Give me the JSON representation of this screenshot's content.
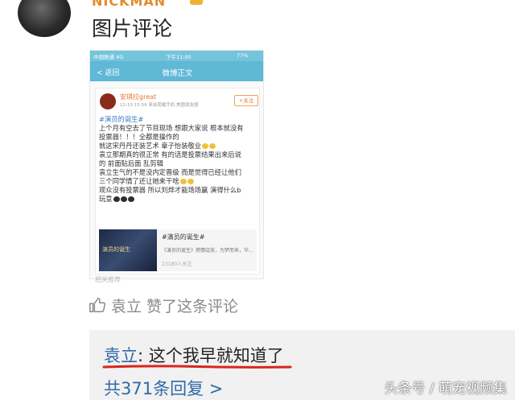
{
  "header": {
    "username": "NICKMAN",
    "comment_text": "图片评论"
  },
  "screenshot": {
    "status": {
      "carrier": "中国联通 4G",
      "time": "下午11:05",
      "battery": "77%"
    },
    "nav": {
      "back": "返回",
      "title": "微博正文"
    },
    "post": {
      "author": "安琪拉great",
      "meta": "12-10 15:59 来自荣耀手机 美图朋友圈",
      "follow": "+关注",
      "hashtag": "#演员的诞生#",
      "lines": [
        "上个月有空去了节目现场 想跟大家说 根本就没有",
        "投票器！！！全都是操作的",
        "就这宋丹丹还装艺术 章子怡装敬业",
        "袁立那期真的很正常 有的话是投票结果出来后说",
        "的 前面贴后面 乱剪辑",
        "袁立生气的不是没内定晋级 而是觉得已经让他们",
        "三个同学情了还让她来干啥",
        "观众没有投票器 所以刘烨才能场场赢 演得什么b",
        "玩意"
      ]
    },
    "topic": {
      "image_text": "演员的诞生",
      "title": "#演员的诞生#",
      "desc": "《演员的诞生》燃情绽放，为梦而来，华...",
      "count": "23180人关注"
    },
    "recommend": "相关推荐"
  },
  "like": {
    "text": "袁立 赞了这条评论",
    "icon": "thumbs-up-icon"
  },
  "reply": {
    "author": "袁立",
    "colon": ":",
    "text": " 这个我早就知道了",
    "count": "共371条回复 >",
    "underline_color": "#d9251d"
  },
  "watermark": "头条号 / 萌宠视频集",
  "colors": {
    "link": "#2f6aa8",
    "accent": "#5fb8d6",
    "orange": "#e07a2c"
  }
}
